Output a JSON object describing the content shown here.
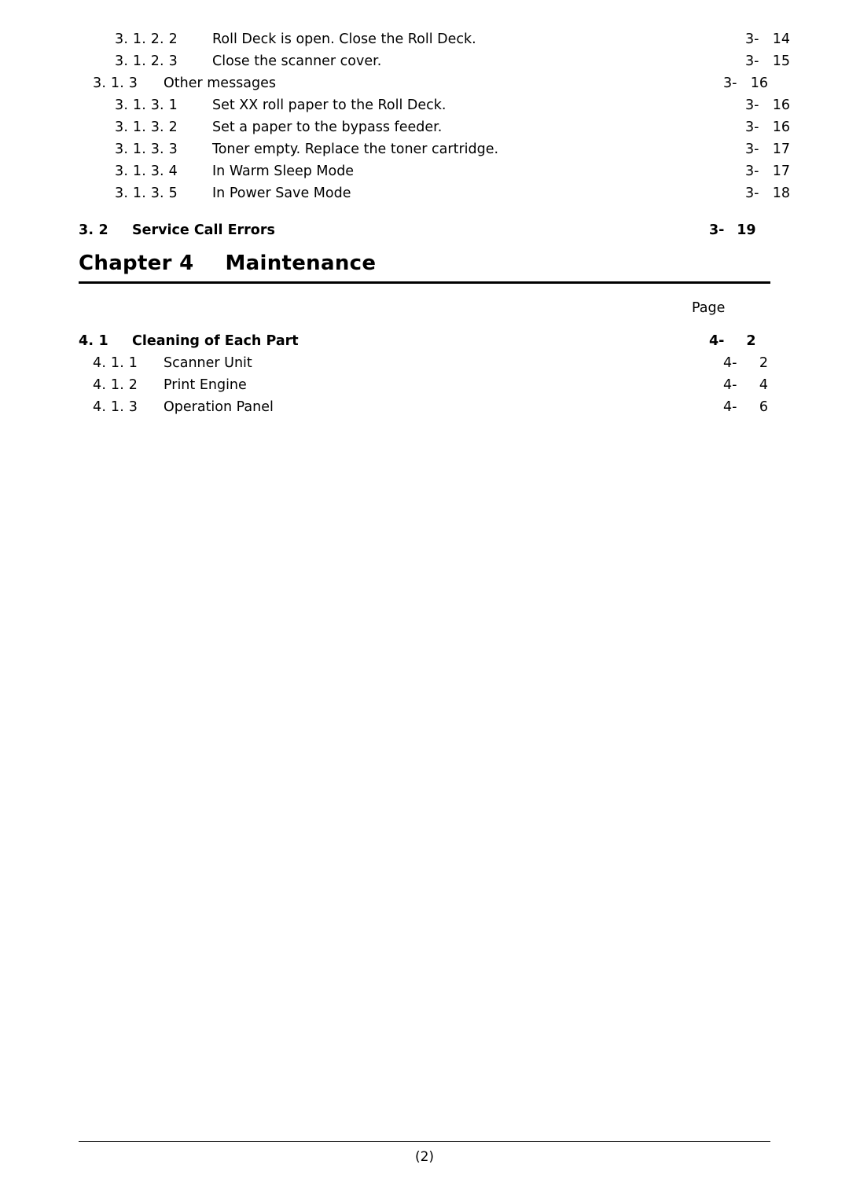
{
  "toc_chapter3": {
    "rows": [
      {
        "num": "3. 1. 2. 2",
        "title": "Roll Deck is open. Close the Roll Deck.",
        "page_prefix": "3-",
        "page": "14",
        "level": 4,
        "bold": false
      },
      {
        "num": "3. 1. 2. 3",
        "title": "Close the scanner cover.",
        "page_prefix": "3-",
        "page": "15",
        "level": 4,
        "bold": false
      },
      {
        "num": "3. 1. 3",
        "title": "Other messages",
        "page_prefix": "3-",
        "page": "16",
        "level": 3,
        "bold": false
      },
      {
        "num": "3. 1. 3. 1",
        "title": "Set XX roll paper to the Roll Deck.",
        "page_prefix": "3-",
        "page": "16",
        "level": 4,
        "bold": false
      },
      {
        "num": "3. 1. 3. 2",
        "title": "Set a paper to the bypass feeder.",
        "page_prefix": "3-",
        "page": "16",
        "level": 4,
        "bold": false
      },
      {
        "num": "3. 1. 3. 3",
        "title": "Toner empty. Replace the toner cartridge.",
        "page_prefix": "3-",
        "page": "17",
        "level": 4,
        "bold": false
      },
      {
        "num": "3. 1. 3. 4",
        "title": "In Warm Sleep Mode",
        "page_prefix": "3-",
        "page": "17",
        "level": 4,
        "bold": false
      },
      {
        "num": "3. 1. 3. 5",
        "title": "In Power Save Mode",
        "page_prefix": "3-",
        "page": "18",
        "level": 4,
        "bold": false
      },
      {
        "num": "3. 2",
        "title": "Service Call Errors",
        "page_prefix": "3-",
        "page": "19",
        "level": 2,
        "bold": true
      }
    ]
  },
  "chapter": {
    "label": "Chapter 4",
    "title": "Maintenance"
  },
  "page_column_label": "Page",
  "toc_chapter4": {
    "rows": [
      {
        "num": "4. 1",
        "title": "Cleaning of Each Part",
        "page_prefix": "4-",
        "page": "2",
        "level": 2,
        "bold": true
      },
      {
        "num": "4. 1. 1",
        "title": "Scanner Unit",
        "page_prefix": "4-",
        "page": "2",
        "level": 3,
        "bold": false
      },
      {
        "num": "4. 1. 2",
        "title": "Print Engine",
        "page_prefix": "4-",
        "page": "4",
        "level": 3,
        "bold": false
      },
      {
        "num": "4. 1. 3",
        "title": "Operation Panel",
        "page_prefix": "4-",
        "page": "6",
        "level": 3,
        "bold": false
      }
    ]
  },
  "footer": {
    "page_number": "(2)"
  }
}
